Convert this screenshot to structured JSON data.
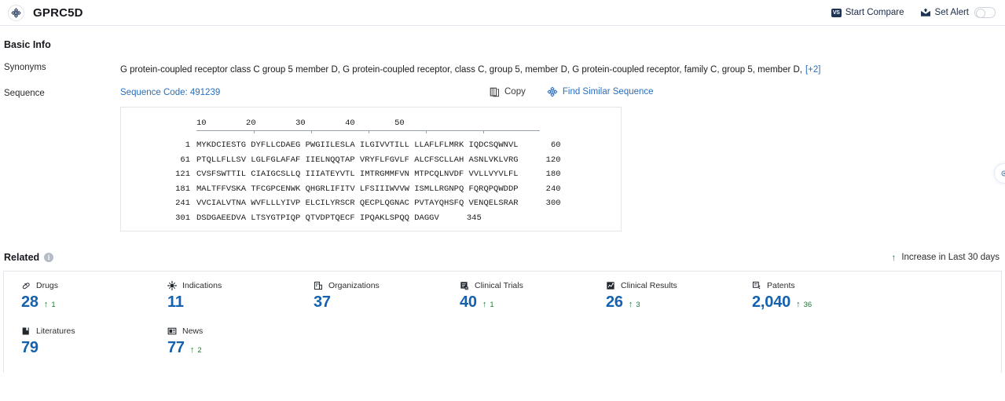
{
  "header": {
    "logo_icon": "target-crosshair-icon",
    "title": "GPRC5D",
    "start_compare": {
      "label": "Start Compare",
      "icon": "vs-badge-icon",
      "badge_text": "VS"
    },
    "set_alert": {
      "label": "Set Alert",
      "icon": "alert-mail-icon",
      "toggle_state": "off"
    }
  },
  "basic_info": {
    "section_title": "Basic Info",
    "synonyms": {
      "label": "Synonyms",
      "value": "G protein-coupled receptor class C group 5 member D,  G protein-coupled receptor, class C, group 5, member D,  G protein-coupled receptor, family C, group 5, member D,",
      "more": "[+2]"
    },
    "sequence": {
      "label": "Sequence",
      "code_label": "Sequence Code: 491239",
      "copy_label": "Copy",
      "copy_icon": "copy-icon",
      "find_similar_label": "Find Similar Sequence",
      "find_similar_icon": "target-crosshair-icon",
      "ruler_ticks": [
        "10",
        "20",
        "30",
        "40",
        "50"
      ],
      "rows": [
        {
          "start": "1",
          "chunks": "MYKDCIESTG DYFLLCDAEG PWGIILESLA ILGIVVTILL LLAFLFLMRK IQDCSQWNVL",
          "end": "60"
        },
        {
          "start": "61",
          "chunks": "PTQLLFLLSV LGLFGLAFAF IIELNQQTAP VRYFLFGVLF ALCFSCLLAH ASNLVKLVRG",
          "end": "120"
        },
        {
          "start": "121",
          "chunks": "CVSFSWTTIL CIAIGCSLLQ IIIATEYVTL IMTRGMMFVN MTPCQLNVDF VVLLVYVLFL",
          "end": "180"
        },
        {
          "start": "181",
          "chunks": "MALTFFVSKA TFCGPCENWK QHGRLIFITV LFSIIIWVVW ISMLLRGNPQ FQRQPQWDDP",
          "end": "240"
        },
        {
          "start": "241",
          "chunks": "VVCIALVTNA WVFLLLYIVP ELCILYRSCR QECPLQGNAC PVTAYQHSFQ VENQELSRAR",
          "end": "300"
        },
        {
          "start": "301",
          "chunks": "DSDGAEEDVA LTSYGTPIQP QTVDPTQECF IPQAKLSPQQ DAGGV",
          "end": "345"
        }
      ]
    }
  },
  "related": {
    "title": "Related",
    "info_icon": "info-icon",
    "legend": "Increase in Last 30 days",
    "legend_icon": "up-arrow-icon",
    "cards": [
      {
        "label": "Drugs",
        "icon": "capsule-pill-icon",
        "value": "28",
        "delta": "1"
      },
      {
        "label": "Indications",
        "icon": "virus-icon",
        "value": "11",
        "delta": ""
      },
      {
        "label": "Organizations",
        "icon": "building-icon",
        "value": "37",
        "delta": ""
      },
      {
        "label": "Clinical Trials",
        "icon": "clipboard-check-icon",
        "value": "40",
        "delta": "1"
      },
      {
        "label": "Clinical Results",
        "icon": "chart-report-icon",
        "value": "26",
        "delta": "3"
      },
      {
        "label": "Patents",
        "icon": "certificate-icon",
        "value": "2,040",
        "delta": "36"
      },
      {
        "label": "Literatures",
        "icon": "book-icon",
        "value": "79",
        "delta": ""
      },
      {
        "label": "News",
        "icon": "newspaper-icon",
        "value": "77",
        "delta": "2"
      }
    ]
  },
  "colors": {
    "link_blue": "#2a6ebb",
    "number_blue": "#1561ad",
    "increase_green": "#1d7a32",
    "header_dark": "#1f3352"
  }
}
